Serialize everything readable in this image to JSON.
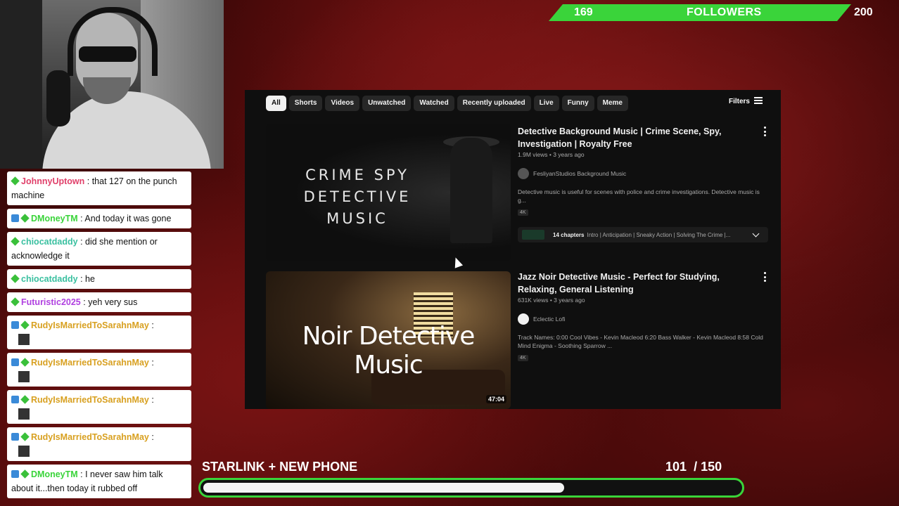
{
  "followers": {
    "current": "169",
    "label": "FOLLOWERS",
    "goal": "200"
  },
  "chat": [
    {
      "badges": [
        "diamond"
      ],
      "user": "JohnnyUptown",
      "color": "#e0406a",
      "text": ": that 127 on the punch machine",
      "avatar": false
    },
    {
      "badges": [
        "blue",
        "diamond"
      ],
      "user": "DMoneyTM",
      "color": "#3ad43a",
      "text": ": And today it was gone",
      "avatar": false
    },
    {
      "badges": [
        "diamond"
      ],
      "user": "chiocatdaddy",
      "color": "#3ac0a0",
      "text": ": did she mention or acknowledge it",
      "avatar": false
    },
    {
      "badges": [
        "diamond"
      ],
      "user": "chiocatdaddy",
      "color": "#3ac0a0",
      "text": ": he",
      "avatar": false
    },
    {
      "badges": [
        "diamond"
      ],
      "user": "Futuristic2025",
      "color": "#b040e0",
      "text": ": yeh very sus",
      "avatar": false
    },
    {
      "badges": [
        "blue",
        "diamond"
      ],
      "user": "RudyIsMarriedToSarahnMay",
      "color": "#d8a020",
      "text": ":",
      "avatar": true
    },
    {
      "badges": [
        "blue",
        "diamond"
      ],
      "user": "RudyIsMarriedToSarahnMay",
      "color": "#d8a020",
      "text": ":",
      "avatar": true
    },
    {
      "badges": [
        "blue",
        "diamond"
      ],
      "user": "RudyIsMarriedToSarahnMay",
      "color": "#d8a020",
      "text": ":",
      "avatar": true
    },
    {
      "badges": [
        "blue",
        "diamond"
      ],
      "user": "RudyIsMarriedToSarahnMay",
      "color": "#d8a020",
      "text": ":",
      "avatar": true
    },
    {
      "badges": [
        "blue",
        "diamond"
      ],
      "user": "DMoneyTM",
      "color": "#3ad43a",
      "text": ": I never saw him talk about it...then today it rubbed off",
      "avatar": false
    }
  ],
  "youtube": {
    "chips": [
      "All",
      "Shorts",
      "Videos",
      "Unwatched",
      "Watched",
      "Recently uploaded",
      "Live",
      "Funny",
      "Meme"
    ],
    "active_chip": "All",
    "filters_label": "Filters",
    "videos": [
      {
        "thumb_text": "CRIME SPY DETECTIVE MUSIC",
        "title": "Detective Background Music | Crime Scene, Spy, Investigation | Royalty Free",
        "meta": "1.9M views • 3 years ago",
        "channel": "FesliyanStudios Background Music",
        "description": "Detective music is useful for scenes with police and crime investigations. Detective music is g...",
        "quality": "4K",
        "chapters_count": "14 chapters",
        "chapters_list": "Intro | Anticipation | Sneaky Action | Solving The Crime |..."
      },
      {
        "thumb_text": "Noir Detective Music",
        "duration": "47:04",
        "title": "Jazz Noir Detective Music - Perfect for Studying, Relaxing, General Listening",
        "meta": "631K views • 3 years ago",
        "channel": "Eclectic Lofi",
        "description": "Track Names: 0:00 Cool Vibes - Kevin Macleod 6:20 Bass Walker - Kevin Macleod 8:58 Cold Mind Enigma - Soothing Sparrow ...",
        "quality": "4K"
      }
    ]
  },
  "goal": {
    "label": "STARLINK + NEW PHONE",
    "current": "101",
    "separator": "/",
    "target": "150",
    "progress": 0.673
  }
}
